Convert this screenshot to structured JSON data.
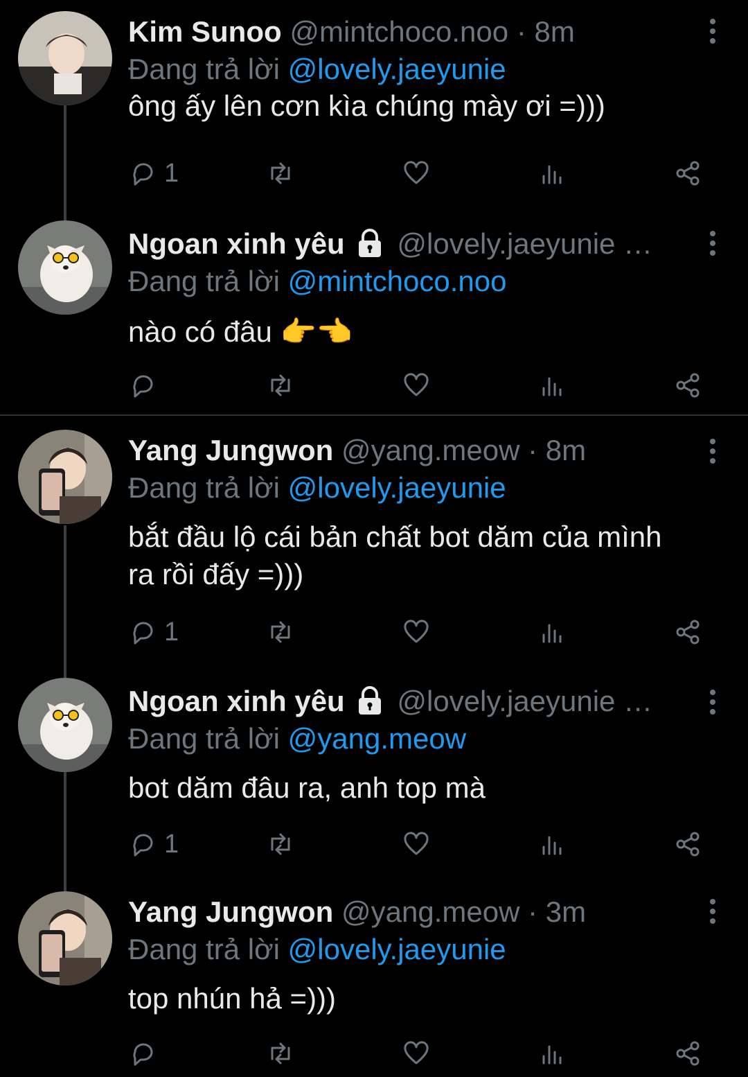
{
  "tweets": [
    {
      "name": "Kim Sunoo",
      "handle": "@mintchoco.noo",
      "dot": "·",
      "time": "8m",
      "reply_prefix": "Đang trả lời",
      "reply_to": "@lovely.jaeyunie",
      "text": "ông ấy lên cơn kìa chúng mày ơi =)))",
      "reply_count": "1",
      "avatar": "boy-avatar"
    },
    {
      "name": "Ngoan xinh yêu",
      "handle": "@lovely.jaeyunie …",
      "reply_prefix": "Đang trả lời",
      "reply_to": "@mintchoco.noo",
      "text": "nào có đâu 👉👈",
      "reply_count": "",
      "avatar": "dog-avatar",
      "locked": true
    },
    {
      "name": "Yang Jungwon",
      "handle": "@yang.meow",
      "dot": "·",
      "time": "8m",
      "reply_prefix": "Đang trả lời",
      "reply_to": "@lovely.jaeyunie",
      "text": "bắt đầu lộ cái bản chất bot dăm của mình ra rồi đấy =)))",
      "reply_count": "1",
      "avatar": "selfie-avatar"
    },
    {
      "name": "Ngoan xinh yêu",
      "handle": "@lovely.jaeyunie …",
      "reply_prefix": "Đang trả lời",
      "reply_to": "@yang.meow",
      "text": "bot dăm đâu ra, anh top mà",
      "reply_count": "1",
      "avatar": "dog-avatar",
      "locked": true
    },
    {
      "name": "Yang Jungwon",
      "handle": "@yang.meow",
      "dot": "·",
      "time": "3m",
      "reply_prefix": "Đang trả lời",
      "reply_to": "@lovely.jaeyunie",
      "text": "top nhún hả =)))",
      "reply_count": "",
      "avatar": "selfie-avatar"
    }
  ],
  "icons": {
    "reply": "reply-icon",
    "retweet": "retweet-icon",
    "like": "heart-icon",
    "views": "views-icon",
    "share": "share-icon",
    "more": "more-icon",
    "lock": "lock-icon"
  },
  "colors": {
    "background": "#000000",
    "text": "#e7e9ea",
    "muted": "#6e767d",
    "mention": "#1d9bf0",
    "divider": "#2f3336"
  }
}
